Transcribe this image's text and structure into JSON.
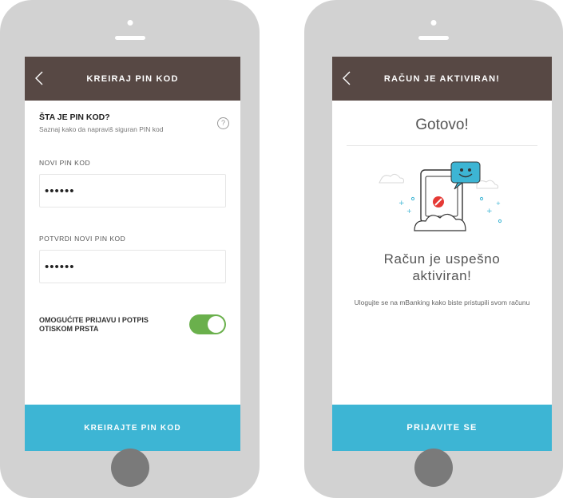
{
  "screen1": {
    "header_title": "KREIRAJ PIN KOD",
    "question_title": "ŠTA JE PIN KOD?",
    "question_subtitle": "Saznaj kako da napraviš siguran PIN kod",
    "help_symbol": "?",
    "new_pin_label": "NOVI PIN KOD",
    "new_pin_value": "••••••",
    "confirm_pin_label": "POTVRDI NOVI PIN KOD",
    "confirm_pin_value": "••••••",
    "toggle_label_line1": "OMOGUĆITE PRIJAVU I POTPIS",
    "toggle_label_line2": "OTISKOM PRSTA",
    "toggle_state": "on",
    "submit_label": "KREIRAJTE PIN KOD"
  },
  "screen2": {
    "header_title": "RAČUN JE AKTIVIRAN!",
    "heading": "Gotovo!",
    "message_line1": "Račun je uspešno",
    "message_line2": "aktiviran!",
    "info_text": "Ulogujte se na mBanking kako biste pristupili svom računu",
    "login_label": "PRIJAVITE SE"
  },
  "colors": {
    "header_bg": "#574844",
    "accent": "#3db5d4",
    "toggle_on": "#6ab04c",
    "phone_frame": "#d2d2d2"
  },
  "icons": {
    "back": "chevron-left-icon",
    "help": "question-circle-icon"
  }
}
